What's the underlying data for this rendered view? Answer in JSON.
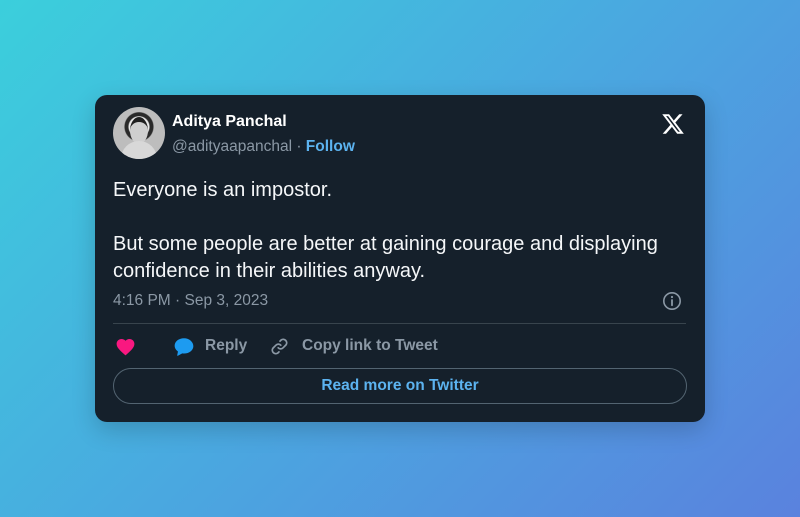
{
  "tweet": {
    "author": {
      "name": "Aditya Panchal",
      "handle": "@adityaapanchal",
      "separator": " · ",
      "follow_label": "Follow"
    },
    "text_paragraph_1": "Everyone is an impostor.",
    "text_paragraph_2": "But some people are better at gaining courage and displaying confidence in their abilities anyway.",
    "timestamp": "4:16 PM · Sep 3, 2023"
  },
  "actions": {
    "reply_label": "Reply",
    "copy_link_label": "Copy link to Tweet"
  },
  "read_more_label": "Read more on Twitter",
  "icons": {
    "brand": "x-logo-icon",
    "info": "info-icon",
    "like": "heart-icon",
    "reply": "reply-icon",
    "copy": "link-icon"
  },
  "colors": {
    "card_background": "#15202b",
    "accent_blue": "#5cb3f0",
    "heart_pink": "#f91880",
    "reply_blue": "#1d9bf0",
    "muted_text": "#8b98a5"
  }
}
